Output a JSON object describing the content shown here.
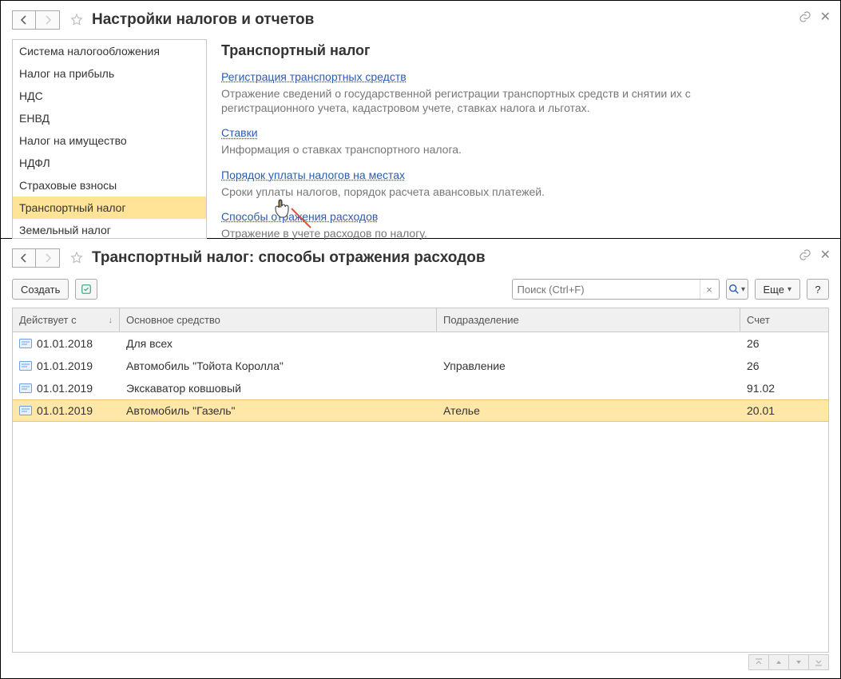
{
  "top": {
    "title": "Настройки налогов и отчетов",
    "sidebar": {
      "items": [
        {
          "label": "Система налогообложения"
        },
        {
          "label": "Налог на прибыль"
        },
        {
          "label": "НДС"
        },
        {
          "label": "ЕНВД"
        },
        {
          "label": "Налог на имущество"
        },
        {
          "label": "НДФЛ"
        },
        {
          "label": "Страховые взносы"
        },
        {
          "label": "Транспортный налог"
        },
        {
          "label": "Земельный налог"
        }
      ],
      "selected_index": 7
    },
    "content": {
      "heading": "Транспортный налог",
      "blocks": [
        {
          "link": "Регистрация транспортных средств",
          "desc": "Отражение сведений о государственной регистрации транспортных средств и снятии их с регистрационного учета, кадастровом учете, ставках налога и льготах."
        },
        {
          "link": "Ставки",
          "desc": "Информация о ставках транспортного налога."
        },
        {
          "link": "Порядок уплаты налогов на местах",
          "desc": "Сроки уплаты налогов, порядок расчета авансовых платежей."
        },
        {
          "link": "Способы отражения расходов",
          "desc": "Отражение в учете расходов по налогу."
        }
      ]
    }
  },
  "bottom": {
    "title": "Транспортный налог: способы отражения расходов",
    "toolbar": {
      "create": "Создать",
      "more": "Еще",
      "search_placeholder": "Поиск (Ctrl+F)"
    },
    "columns": {
      "date": "Действует с",
      "asset": "Основное средство",
      "dept": "Подразделение",
      "acct": "Счет"
    },
    "rows": [
      {
        "date": "01.01.2018",
        "asset": "Для всех",
        "dept": "",
        "acct": "26"
      },
      {
        "date": "01.01.2019",
        "asset": "Автомобиль \"Тойота Королла\"",
        "dept": "Управление",
        "acct": "26"
      },
      {
        "date": "01.01.2019",
        "asset": "Экскаватор ковшовый",
        "dept": "",
        "acct": "91.02"
      },
      {
        "date": "01.01.2019",
        "asset": "Автомобиль \"Газель\"",
        "dept": "Ателье",
        "acct": "20.01"
      }
    ],
    "selected_row": 3
  }
}
